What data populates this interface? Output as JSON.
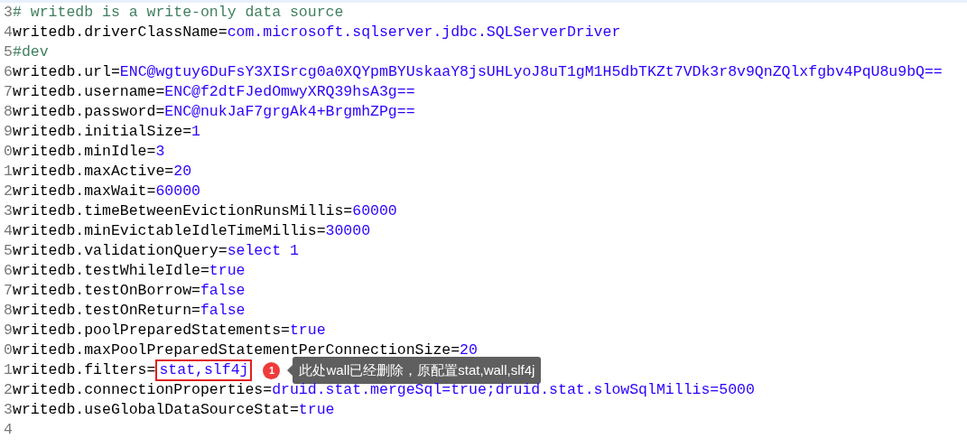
{
  "editor": {
    "lines": [
      {
        "number": "3",
        "kind": "comment",
        "text": "# writedb is a write-only data source"
      },
      {
        "number": "4",
        "kind": "property",
        "key": "writedb.driverClassName=",
        "value": "com.microsoft.sqlserver.jdbc.SQLServerDriver"
      },
      {
        "number": "5",
        "kind": "comment",
        "text": "#dev"
      },
      {
        "number": "6",
        "kind": "property",
        "key": "writedb.url=",
        "value": "ENC@wgtuy6DuFsY3XISrcg0a0XQYpmBYUskaaY8jsUHLyoJ8uT1gM1H5dbTKZt7VDk3r8v9QnZQlxfgbv4PqU8u9bQ=="
      },
      {
        "number": "7",
        "kind": "property",
        "key": "writedb.username=",
        "value": "ENC@f2dtFJedOmwyXRQ39hsA3g=="
      },
      {
        "number": "8",
        "kind": "property",
        "key": "writedb.password=",
        "value": "ENC@nukJaF7grgAk4+BrgmhZPg=="
      },
      {
        "number": "9",
        "kind": "property",
        "key": "writedb.initialSize=",
        "value": "1"
      },
      {
        "number": "0",
        "kind": "property",
        "key": "writedb.minIdle=",
        "value": "3"
      },
      {
        "number": "1",
        "kind": "property",
        "key": "writedb.maxActive=",
        "value": "20"
      },
      {
        "number": "2",
        "kind": "property",
        "key": "writedb.maxWait=",
        "value": "60000"
      },
      {
        "number": "3",
        "kind": "property",
        "key": "writedb.timeBetweenEvictionRunsMillis=",
        "value": "60000"
      },
      {
        "number": "4",
        "kind": "property",
        "key": "writedb.minEvictableIdleTimeMillis=",
        "value": "30000"
      },
      {
        "number": "5",
        "kind": "property",
        "key": "writedb.validationQuery=",
        "value": "select 1"
      },
      {
        "number": "6",
        "kind": "property",
        "key": "writedb.testWhileIdle=",
        "value": "true"
      },
      {
        "number": "7",
        "kind": "property",
        "key": "writedb.testOnBorrow=",
        "value": "false"
      },
      {
        "number": "8",
        "kind": "property",
        "key": "writedb.testOnReturn=",
        "value": "false"
      },
      {
        "number": "9",
        "kind": "property",
        "key": "writedb.poolPreparedStatements=",
        "value": "true"
      },
      {
        "number": "0",
        "kind": "property",
        "key": "writedb.maxPoolPreparedStatementPerConnectionSize=",
        "value": "20"
      },
      {
        "number": "1",
        "kind": "property",
        "key": "writedb.filters=",
        "value": "stat,slf4j",
        "annotation": {
          "badge": "1",
          "text": "此处wall已经删除，原配置stat,wall,slf4j"
        }
      },
      {
        "number": "2",
        "kind": "property",
        "key": "writedb.connectionProperties=",
        "value": "druid.stat.mergeSql=true;druid.stat.slowSqlMillis=5000"
      },
      {
        "number": "3",
        "kind": "property",
        "key": "writedb.useGlobalDataSourceStat=",
        "value": "true"
      },
      {
        "number": "4",
        "kind": "blank"
      }
    ]
  }
}
